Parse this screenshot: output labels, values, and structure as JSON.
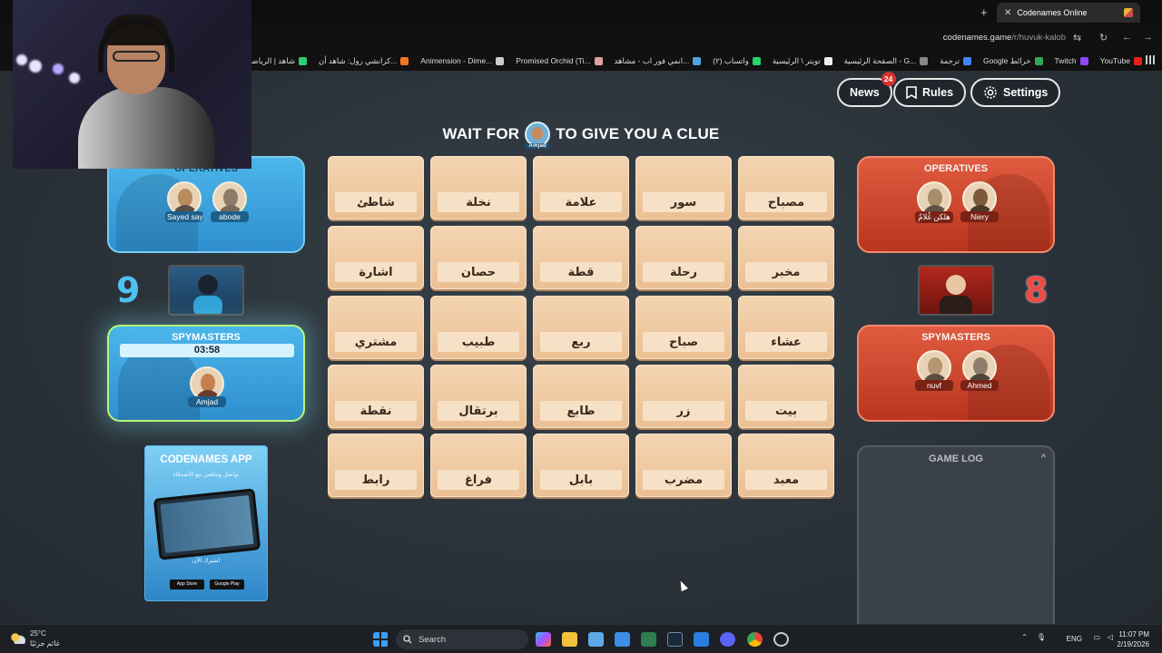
{
  "browser": {
    "tab_title": "Codenames Online",
    "tab_close": "✕",
    "new_tab": "+",
    "url_domain": "codenames.game",
    "url_path": "/r/huvuk-kalob",
    "bookmarks": [
      {
        "label": "YouTube",
        "color": "#e62117"
      },
      {
        "label": "Twitch",
        "color": "#9146ff"
      },
      {
        "label": "Google خرائط",
        "color": "#34a853"
      },
      {
        "label": "ترجمة",
        "color": "#4285f4"
      },
      {
        "label": "الصفحة الرئيسية - G...",
        "color": "#888888"
      },
      {
        "label": "تويتر \\ الرئيسية",
        "color": "#eeeeee"
      },
      {
        "label": "(٢) واتساب",
        "color": "#25d366"
      },
      {
        "label": "انمي فور اب - مشاهد...",
        "color": "#4fa3e0"
      },
      {
        "label": "Promised Orchid (Ti...",
        "color": "#e0a0a0"
      },
      {
        "label": "Animension - Dime...",
        "color": "#cccccc"
      },
      {
        "label": "كرانشي رول: شاهد أن...",
        "color": "#f47521"
      },
      {
        "label": "شاهد | الرياضة",
        "color": "#2ecc71"
      }
    ]
  },
  "header": {
    "news_label": "News",
    "news_count": "24",
    "rules_label": "Rules",
    "settings_label": "Settings",
    "clue_prefix": "WAIT FOR",
    "clue_player": "Amjad",
    "clue_suffix": "TO GIVE YOU A CLUE"
  },
  "blue_team": {
    "operatives_title": "OPERATIVES",
    "operatives": [
      "Sayed say",
      "abode"
    ],
    "score": "9",
    "spymasters_title": "SPYMASTERS",
    "timer": "03:58",
    "spymasters": [
      "Amjad"
    ],
    "color": "#3fa9e4"
  },
  "red_team": {
    "operatives_title": "OPERATIVES",
    "operatives": [
      "هلكن غُلامٌ",
      "Niery"
    ],
    "score": "8",
    "spymasters_title": "SPYMASTERS",
    "spymasters": [
      "nuvf",
      "Ahmed"
    ],
    "color": "#d0472d"
  },
  "board": {
    "cards": [
      "شاطئ",
      "نخلة",
      "علامة",
      "سور",
      "مصباح",
      "اشارة",
      "حصان",
      "قطة",
      "رحلة",
      "مخبر",
      "مشتري",
      "طبيب",
      "ربع",
      "صباح",
      "عشاء",
      "نقطة",
      "برتقال",
      "طابع",
      "زر",
      "بيت",
      "رابط",
      "فراغ",
      "بابل",
      "مضرب",
      "معبد"
    ]
  },
  "promo": {
    "title": "CODENAMES APP",
    "subtitle": "تواصل وتنافس مع الأصدقاء",
    "cta": "اشترك الآن",
    "app_store": "App Store",
    "google_play": "Google Play"
  },
  "game_log": {
    "title": "GAME LOG",
    "chevron": "^"
  },
  "taskbar": {
    "temperature": "25°C",
    "weather_desc": "غائم جزئيًا",
    "search_placeholder": "Search",
    "lang": "ENG",
    "time": "11:07 PM",
    "date": "2/19/2026"
  }
}
